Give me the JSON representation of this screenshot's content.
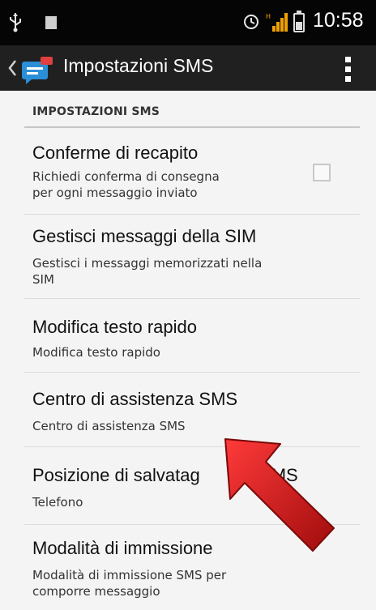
{
  "status_bar": {
    "time": "10:58",
    "icons": [
      "usb-icon",
      "gallery-icon",
      "alarm-icon",
      "signal-icon",
      "battery-icon"
    ]
  },
  "action_bar": {
    "title": "Impostazioni SMS",
    "icons": [
      "back-icon",
      "messaging-app-icon",
      "overflow-menu-icon"
    ]
  },
  "section": {
    "header": "IMPOSTAZIONI SMS"
  },
  "preferences": [
    {
      "title": "Conferme di recapito",
      "summary_lines": [
        "Richiedi conferma di consegna",
        "per ogni messaggio inviato"
      ],
      "checkbox_checked": false
    },
    {
      "title": "Gestisci messaggi della SIM",
      "summary_lines": [
        "Gestisci i messaggi memorizzati nella",
        "SIM"
      ]
    },
    {
      "title": "Modifica testo rapido",
      "summary_lines": [
        "Modifica testo rapido"
      ]
    },
    {
      "title": "Centro di assistenza SMS",
      "summary_lines": [
        "Centro di assistenza SMS"
      ]
    },
    {
      "title_parts": [
        "Posizione di salvatag",
        "MS"
      ],
      "summary_lines": [
        "Telefono"
      ]
    },
    {
      "title": "Modalità di immissione",
      "summary_lines": [
        "Modalità di immissione SMS per",
        "comporre messaggio"
      ]
    }
  ],
  "colors": {
    "status_bar_bg": "#050505",
    "action_bar_bg": "#202020",
    "content_bg": "#f4f4f4",
    "signal_accent": "#f0a000",
    "app_icon_blue": "#2a8fd6",
    "app_icon_badge": "#e04040",
    "arrow_red": "#d01818"
  },
  "annotation": {
    "type": "red-arrow-icon",
    "points_to": "Centro di assistenza SMS"
  }
}
